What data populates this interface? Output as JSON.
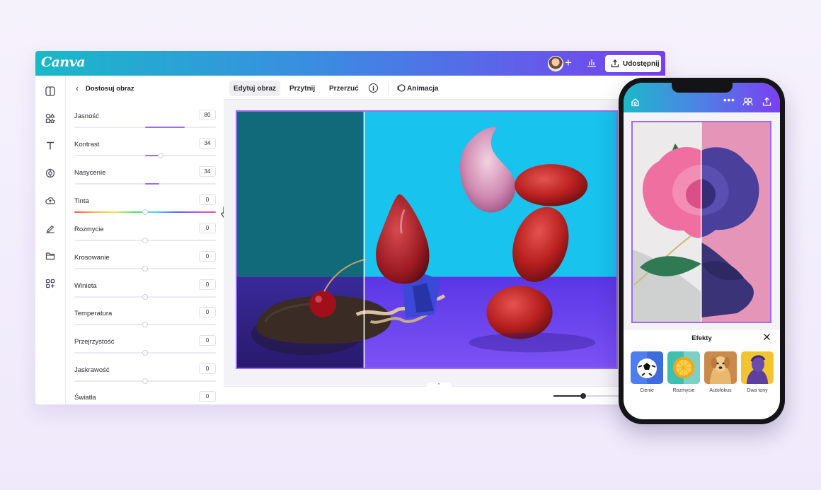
{
  "app": {
    "logo": "Canva",
    "share_label": "Udostępnij"
  },
  "panel": {
    "title": "Dostosuj obraz",
    "adjustments": [
      {
        "label": "Jasność",
        "value": "80"
      },
      {
        "label": "Kontrast",
        "value": "34"
      },
      {
        "label": "Nasycenie",
        "value": "34"
      },
      {
        "label": "Tinta",
        "value": "0"
      },
      {
        "label": "Rozmycie",
        "value": "0"
      },
      {
        "label": "Krosowanie",
        "value": "0"
      },
      {
        "label": "Winieta",
        "value": "0"
      },
      {
        "label": "Temperatura",
        "value": "0"
      },
      {
        "label": "Przejrzystość",
        "value": "0"
      },
      {
        "label": "Jaskrawość",
        "value": "0"
      },
      {
        "label": "Światła",
        "value": "0"
      }
    ]
  },
  "toolbar": {
    "edit": "Edytuj obraz",
    "crop": "Przytnij",
    "flip": "Przerzuć",
    "info": "i",
    "animate": "Animacja"
  },
  "phone": {
    "effects_title": "Efekty",
    "effects": [
      {
        "label": "Cienie"
      },
      {
        "label": "Rozmycie"
      },
      {
        "label": "Autofokus"
      },
      {
        "label": "Dwa tony"
      }
    ]
  },
  "colors": {
    "accent": "#9b6cf3",
    "brand_start": "#19b9c8",
    "brand_end": "#7a3ff0"
  },
  "icons": {
    "rail": [
      "layout-icon",
      "elements-icon",
      "text-icon",
      "brand-icon",
      "uploads-icon",
      "draw-icon",
      "folder-icon",
      "apps-icon"
    ]
  }
}
